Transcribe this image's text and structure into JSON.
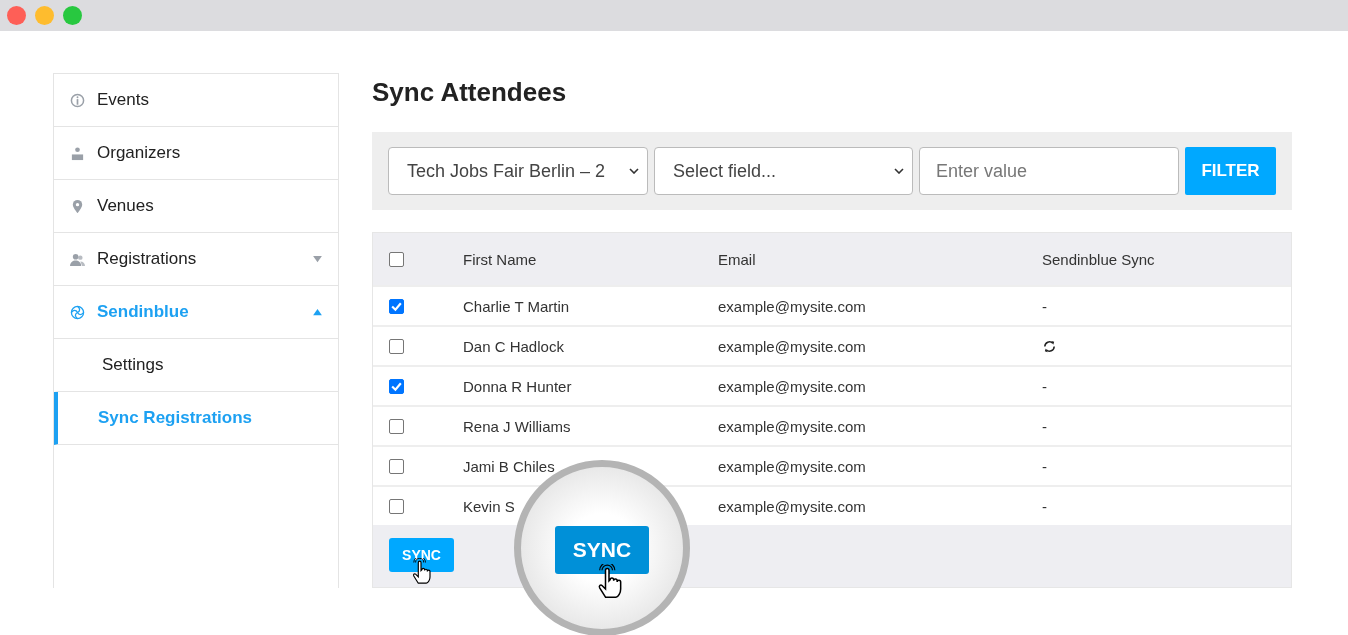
{
  "sidebar": {
    "items": [
      {
        "label": "Events",
        "selected": false
      },
      {
        "label": "Organizers",
        "selected": false
      },
      {
        "label": "Venues",
        "selected": false
      },
      {
        "label": "Registrations",
        "selected": false,
        "expanded": false
      },
      {
        "label": "Sendinblue",
        "selected": true,
        "expanded": true,
        "children": [
          {
            "label": "Settings",
            "selected": false
          },
          {
            "label": "Sync Registrations",
            "selected": true
          }
        ]
      }
    ]
  },
  "page": {
    "title": "Sync Attendees"
  },
  "filter": {
    "event_select": "Tech Jobs Fair Berlin – 2",
    "field_select": "Select field...",
    "value_placeholder": "Enter value",
    "button": "FILTER"
  },
  "table": {
    "columns": [
      "First Name",
      "Email",
      "Sendinblue Sync"
    ],
    "all_checked": false,
    "rows": [
      {
        "first_name": "Charlie T Martin",
        "email": "example@mysite.com",
        "sync": {
          "kind": "text",
          "text": "-"
        },
        "checked": true
      },
      {
        "first_name": "Dan C Hadlock",
        "email": "example@mysite.com",
        "sync": {
          "kind": "syncing"
        },
        "checked": false
      },
      {
        "first_name": "Donna R Hunter",
        "email": "example@mysite.com",
        "sync": {
          "kind": "text",
          "text": "-"
        },
        "checked": true
      },
      {
        "first_name": "Rena J Williams",
        "email": "example@mysite.com",
        "sync": {
          "kind": "text",
          "text": "-"
        },
        "checked": false
      },
      {
        "first_name": "Jami B Chiles",
        "email": "example@mysite.com",
        "sync": {
          "kind": "text",
          "text": "-"
        },
        "checked": false
      },
      {
        "first_name": "Kevin S",
        "email": "example@mysite.com",
        "sync": {
          "kind": "text",
          "text": "-"
        },
        "checked": false
      }
    ],
    "sync_button": "SYNC"
  },
  "magnifier": {
    "button": "SYNC"
  }
}
